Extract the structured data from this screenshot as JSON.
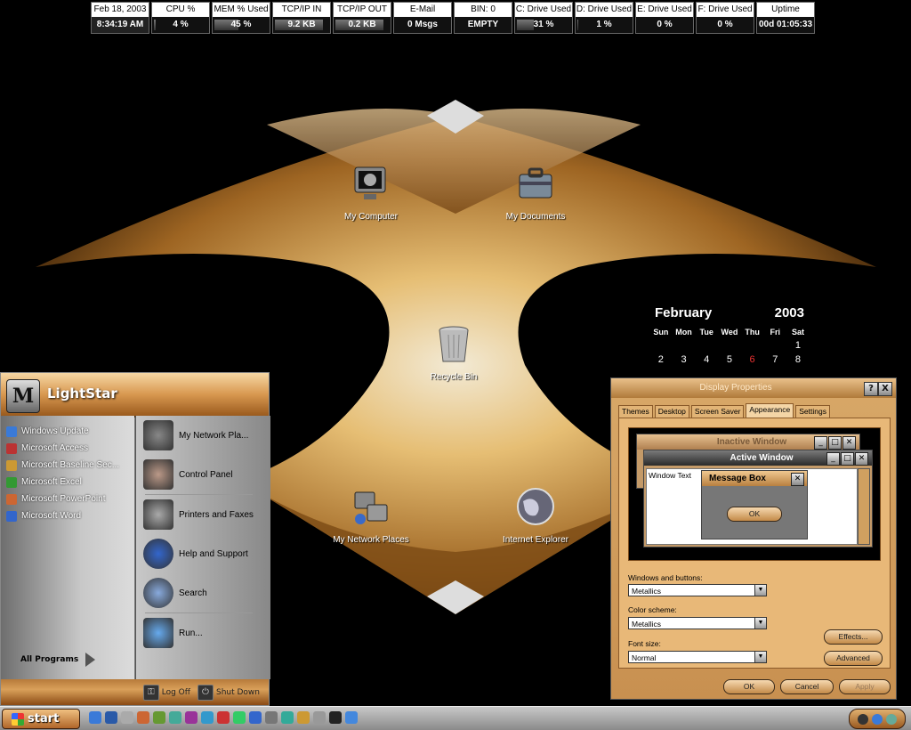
{
  "stats": [
    {
      "label": "Feb 18, 2003",
      "value": "8:34:19 AM",
      "bar": 0
    },
    {
      "label": "CPU %",
      "value": "4 %",
      "bar": 0.04
    },
    {
      "label": "MEM % Used",
      "value": "45 %",
      "bar": 0.45
    },
    {
      "label": "TCP/IP IN",
      "value": "9.2 KB",
      "bar": 0.9
    },
    {
      "label": "TCP/IP OUT",
      "value": "0.2 KB",
      "bar": 0.9
    },
    {
      "label": "E-Mail",
      "value": "0 Msgs",
      "bar": 0
    },
    {
      "label": "BIN: 0",
      "value": "EMPTY",
      "bar": 0
    },
    {
      "label": "C: Drive Used",
      "value": "31 %",
      "bar": 0.31
    },
    {
      "label": "D: Drive Used",
      "value": "1 %",
      "bar": 0.01
    },
    {
      "label": "E: Drive Used",
      "value": "0 %",
      "bar": 0
    },
    {
      "label": "F: Drive Used",
      "value": "0 %",
      "bar": 0
    },
    {
      "label": "Uptime",
      "value": "00d 01:05:33",
      "bar": 0
    }
  ],
  "desktop_icons": {
    "my_computer": "My Computer",
    "my_documents": "My Documents",
    "recycle_bin": "Recycle Bin",
    "my_network": "My Network Places",
    "internet_explorer": "Internet Explorer"
  },
  "calendar": {
    "month": "February",
    "year": "2003",
    "days": [
      "Sun",
      "Mon",
      "Tue",
      "Wed",
      "Thu",
      "Fri",
      "Sat"
    ],
    "row1": [
      "",
      "",
      "",
      "",
      "",
      "",
      "1"
    ],
    "row2": [
      "2",
      "3",
      "4",
      "5",
      "6",
      "7",
      "8"
    ],
    "today": "6"
  },
  "start_menu": {
    "user": "LightStar",
    "logo": "M",
    "left_items": [
      "Windows Update",
      "Microsoft Access",
      "Microsoft Baseline Sec...",
      "Microsoft Excel",
      "Microsoft PowerPoint",
      "Microsoft Word"
    ],
    "all_programs": "All Programs",
    "right_items": [
      "My Network Pla...",
      "Control Panel",
      "Printers and Faxes",
      "Help and Support",
      "Search",
      "Run..."
    ],
    "log_off": "Log Off",
    "shut_down": "Shut Down"
  },
  "dialog": {
    "title": "Display Properties",
    "help_btn": "?",
    "close_btn": "X",
    "tabs": [
      "Themes",
      "Desktop",
      "Screen Saver",
      "Appearance",
      "Settings"
    ],
    "active_tab": "Appearance",
    "inactive_window": "Inactive Window",
    "active_window": "Active Window",
    "window_text": "Window Text",
    "message_box": "Message Box",
    "ok_preview": "OK",
    "windows_buttons_label": "Windows and buttons:",
    "windows_buttons_value": "Metallics",
    "color_scheme_label": "Color scheme:",
    "color_scheme_value": "Metallics",
    "font_size_label": "Font size:",
    "font_size_value": "Normal",
    "effects": "Effects...",
    "advanced": "Advanced",
    "ok": "OK",
    "cancel": "Cancel",
    "apply": "Apply"
  },
  "taskbar": {
    "start": "start"
  },
  "colors": {
    "gold": "#d89850",
    "dark": "#000000"
  }
}
